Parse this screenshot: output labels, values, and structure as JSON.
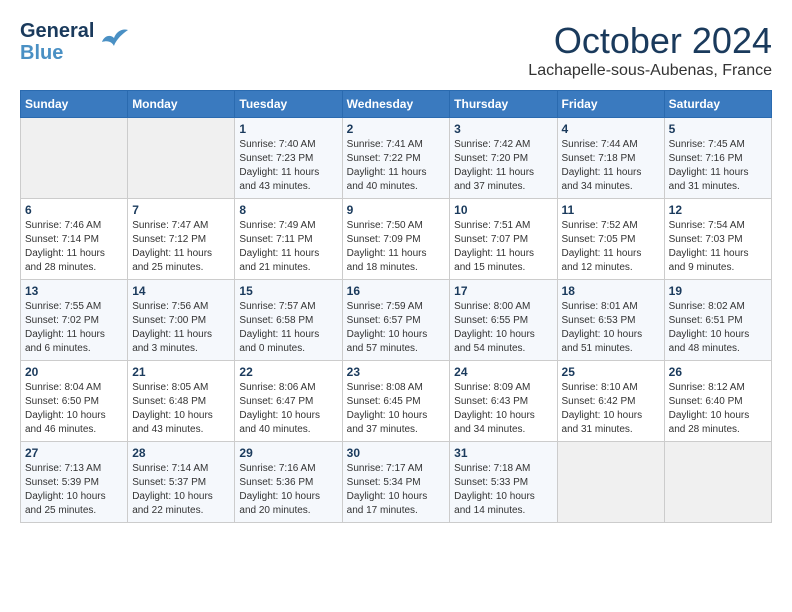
{
  "header": {
    "logo_line1": "General",
    "logo_line2": "Blue",
    "month": "October 2024",
    "location": "Lachapelle-sous-Aubenas, France"
  },
  "weekdays": [
    "Sunday",
    "Monday",
    "Tuesday",
    "Wednesday",
    "Thursday",
    "Friday",
    "Saturday"
  ],
  "weeks": [
    [
      {
        "day": "",
        "info": ""
      },
      {
        "day": "",
        "info": ""
      },
      {
        "day": "1",
        "info": "Sunrise: 7:40 AM\nSunset: 7:23 PM\nDaylight: 11 hours and 43 minutes."
      },
      {
        "day": "2",
        "info": "Sunrise: 7:41 AM\nSunset: 7:22 PM\nDaylight: 11 hours and 40 minutes."
      },
      {
        "day": "3",
        "info": "Sunrise: 7:42 AM\nSunset: 7:20 PM\nDaylight: 11 hours and 37 minutes."
      },
      {
        "day": "4",
        "info": "Sunrise: 7:44 AM\nSunset: 7:18 PM\nDaylight: 11 hours and 34 minutes."
      },
      {
        "day": "5",
        "info": "Sunrise: 7:45 AM\nSunset: 7:16 PM\nDaylight: 11 hours and 31 minutes."
      }
    ],
    [
      {
        "day": "6",
        "info": "Sunrise: 7:46 AM\nSunset: 7:14 PM\nDaylight: 11 hours and 28 minutes."
      },
      {
        "day": "7",
        "info": "Sunrise: 7:47 AM\nSunset: 7:12 PM\nDaylight: 11 hours and 25 minutes."
      },
      {
        "day": "8",
        "info": "Sunrise: 7:49 AM\nSunset: 7:11 PM\nDaylight: 11 hours and 21 minutes."
      },
      {
        "day": "9",
        "info": "Sunrise: 7:50 AM\nSunset: 7:09 PM\nDaylight: 11 hours and 18 minutes."
      },
      {
        "day": "10",
        "info": "Sunrise: 7:51 AM\nSunset: 7:07 PM\nDaylight: 11 hours and 15 minutes."
      },
      {
        "day": "11",
        "info": "Sunrise: 7:52 AM\nSunset: 7:05 PM\nDaylight: 11 hours and 12 minutes."
      },
      {
        "day": "12",
        "info": "Sunrise: 7:54 AM\nSunset: 7:03 PM\nDaylight: 11 hours and 9 minutes."
      }
    ],
    [
      {
        "day": "13",
        "info": "Sunrise: 7:55 AM\nSunset: 7:02 PM\nDaylight: 11 hours and 6 minutes."
      },
      {
        "day": "14",
        "info": "Sunrise: 7:56 AM\nSunset: 7:00 PM\nDaylight: 11 hours and 3 minutes."
      },
      {
        "day": "15",
        "info": "Sunrise: 7:57 AM\nSunset: 6:58 PM\nDaylight: 11 hours and 0 minutes."
      },
      {
        "day": "16",
        "info": "Sunrise: 7:59 AM\nSunset: 6:57 PM\nDaylight: 10 hours and 57 minutes."
      },
      {
        "day": "17",
        "info": "Sunrise: 8:00 AM\nSunset: 6:55 PM\nDaylight: 10 hours and 54 minutes."
      },
      {
        "day": "18",
        "info": "Sunrise: 8:01 AM\nSunset: 6:53 PM\nDaylight: 10 hours and 51 minutes."
      },
      {
        "day": "19",
        "info": "Sunrise: 8:02 AM\nSunset: 6:51 PM\nDaylight: 10 hours and 48 minutes."
      }
    ],
    [
      {
        "day": "20",
        "info": "Sunrise: 8:04 AM\nSunset: 6:50 PM\nDaylight: 10 hours and 46 minutes."
      },
      {
        "day": "21",
        "info": "Sunrise: 8:05 AM\nSunset: 6:48 PM\nDaylight: 10 hours and 43 minutes."
      },
      {
        "day": "22",
        "info": "Sunrise: 8:06 AM\nSunset: 6:47 PM\nDaylight: 10 hours and 40 minutes."
      },
      {
        "day": "23",
        "info": "Sunrise: 8:08 AM\nSunset: 6:45 PM\nDaylight: 10 hours and 37 minutes."
      },
      {
        "day": "24",
        "info": "Sunrise: 8:09 AM\nSunset: 6:43 PM\nDaylight: 10 hours and 34 minutes."
      },
      {
        "day": "25",
        "info": "Sunrise: 8:10 AM\nSunset: 6:42 PM\nDaylight: 10 hours and 31 minutes."
      },
      {
        "day": "26",
        "info": "Sunrise: 8:12 AM\nSunset: 6:40 PM\nDaylight: 10 hours and 28 minutes."
      }
    ],
    [
      {
        "day": "27",
        "info": "Sunrise: 7:13 AM\nSunset: 5:39 PM\nDaylight: 10 hours and 25 minutes."
      },
      {
        "day": "28",
        "info": "Sunrise: 7:14 AM\nSunset: 5:37 PM\nDaylight: 10 hours and 22 minutes."
      },
      {
        "day": "29",
        "info": "Sunrise: 7:16 AM\nSunset: 5:36 PM\nDaylight: 10 hours and 20 minutes."
      },
      {
        "day": "30",
        "info": "Sunrise: 7:17 AM\nSunset: 5:34 PM\nDaylight: 10 hours and 17 minutes."
      },
      {
        "day": "31",
        "info": "Sunrise: 7:18 AM\nSunset: 5:33 PM\nDaylight: 10 hours and 14 minutes."
      },
      {
        "day": "",
        "info": ""
      },
      {
        "day": "",
        "info": ""
      }
    ]
  ]
}
